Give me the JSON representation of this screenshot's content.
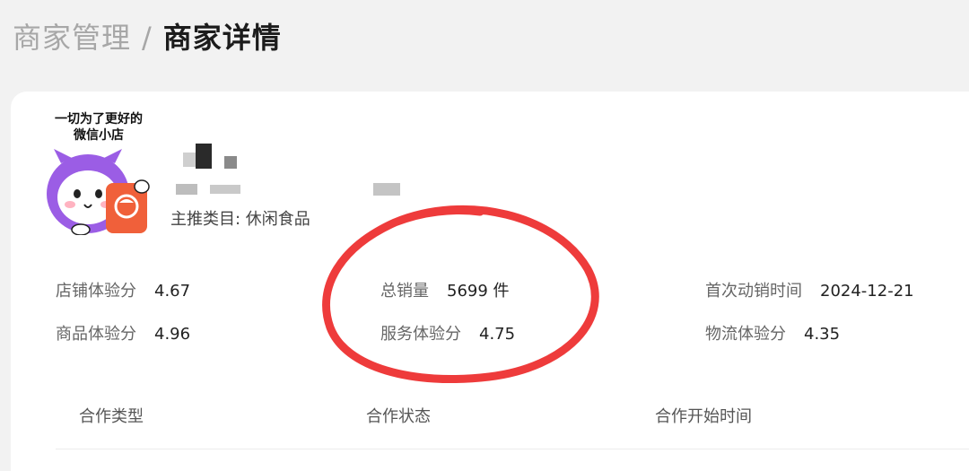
{
  "breadcrumb": {
    "parent": "商家管理",
    "separator": "/",
    "current": "商家详情"
  },
  "store": {
    "logo_text_line1": "一切为了更好的",
    "logo_text_line2": "微信小店",
    "category": "主推类目: 休闲食品"
  },
  "stats": [
    {
      "label": "店铺体验分",
      "value": "4.67"
    },
    {
      "label": "总销量",
      "value": "5699 件"
    },
    {
      "label": "首次动销时间",
      "value": "2024-12-21"
    },
    {
      "label": "商品体验分",
      "value": "4.96"
    },
    {
      "label": "服务体验分",
      "value": "4.75"
    },
    {
      "label": "物流体验分",
      "value": "4.35"
    }
  ],
  "table": {
    "headers": [
      "合作类型",
      "合作状态",
      "合作开始时间"
    ]
  },
  "colors": {
    "annotation_circle": "#ee3b3b",
    "logo_purple": "#9b5de5",
    "logo_orange": "#f0603a"
  }
}
